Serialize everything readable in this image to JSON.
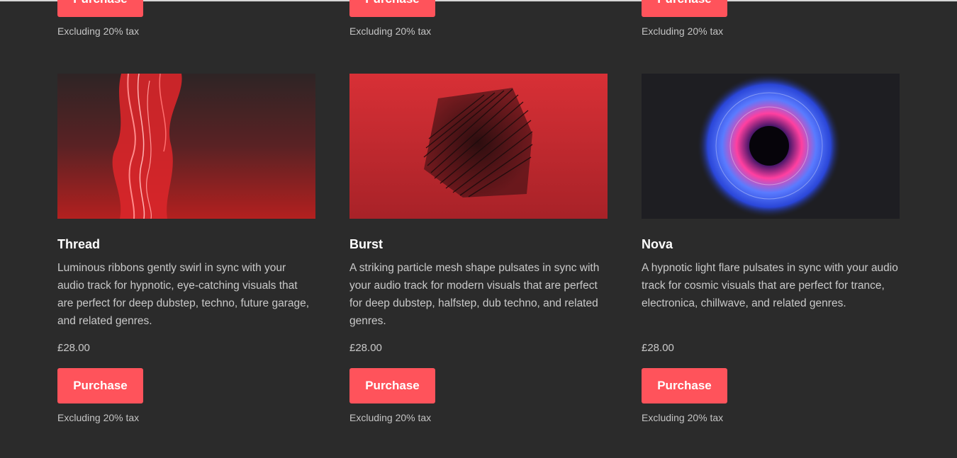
{
  "products": [
    {
      "title": "Thread",
      "description": "Luminous ribbons gently swirl in sync with your audio track for hypnotic, eye-catching visuals that are perfect for deep dubstep, techno, future garage, and related genres.",
      "price": "£28.00",
      "purchase_label": "Purchase",
      "tax_note": "Excluding 20% tax"
    },
    {
      "title": "Burst",
      "description": "A striking particle mesh shape pulsates in sync with your audio track for modern visuals that are perfect for deep dubstep, halfstep, dub techno, and related genres.",
      "price": "£28.00",
      "purchase_label": "Purchase",
      "tax_note": "Excluding 20% tax"
    },
    {
      "title": "Nova",
      "description": "A hypnotic light flare pulsates in sync with your audio track for cosmic visuals that are perfect for trance, electronica, chillwave, and related genres.",
      "price": "£28.00",
      "purchase_label": "Purchase",
      "tax_note": "Excluding 20% tax"
    }
  ],
  "previous_row": {
    "purchase_label": "Purchase",
    "tax_note": "Excluding 20% tax"
  },
  "colors": {
    "background": "#2b2b2b",
    "accent": "#ff535b"
  }
}
